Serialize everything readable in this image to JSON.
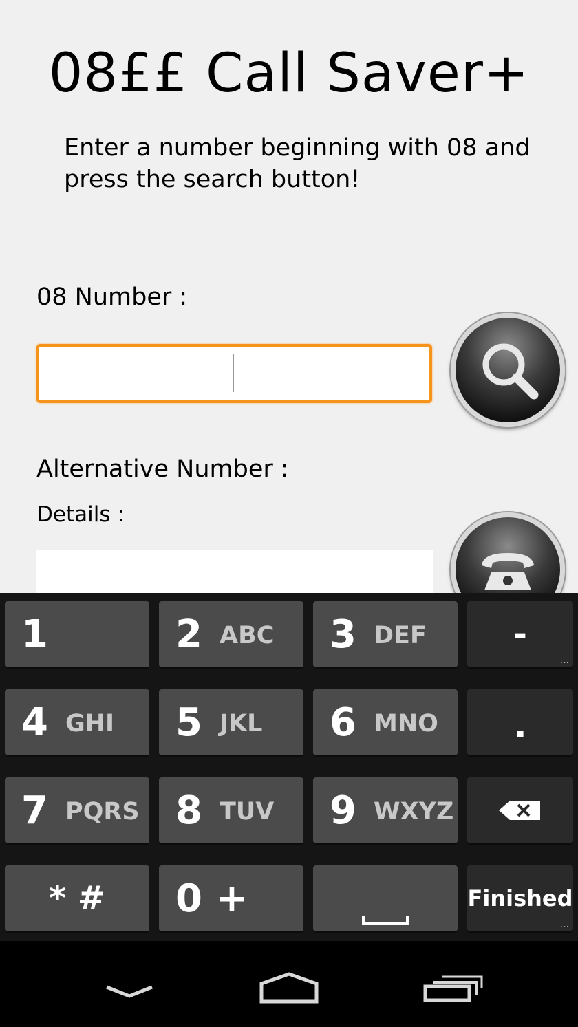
{
  "app": {
    "title": "08££ Call Saver+",
    "instructions": "Enter a number beginning with 08 and press the search button!"
  },
  "form": {
    "number_label": "08 Number :",
    "number_value": "",
    "alternative_label": "Alternative Number :",
    "details_label": "Details :"
  },
  "buttons": {
    "search_icon": "search-icon",
    "call_icon": "phone-icon"
  },
  "keyboard": {
    "keys": [
      {
        "num": "1",
        "letters": ""
      },
      {
        "num": "2",
        "letters": "ABC"
      },
      {
        "num": "3",
        "letters": "DEF"
      },
      {
        "num": "-",
        "letters": ""
      },
      {
        "num": "4",
        "letters": "GHI"
      },
      {
        "num": "5",
        "letters": "JKL"
      },
      {
        "num": "6",
        "letters": "MNO"
      },
      {
        "num": ".",
        "letters": ""
      },
      {
        "num": "7",
        "letters": "PQRS"
      },
      {
        "num": "8",
        "letters": "TUV"
      },
      {
        "num": "9",
        "letters": "WXYZ"
      },
      {
        "num": "",
        "letters": ""
      },
      {
        "num": "* #",
        "letters": ""
      },
      {
        "num": "0 +",
        "letters": ""
      },
      {
        "num": "",
        "letters": ""
      },
      {
        "num": "Finished",
        "letters": ""
      }
    ],
    "more_indicator": "..."
  },
  "colors": {
    "accent": "#f7941d",
    "background": "#f0f0f0",
    "keyboard_bg": "#151515"
  }
}
